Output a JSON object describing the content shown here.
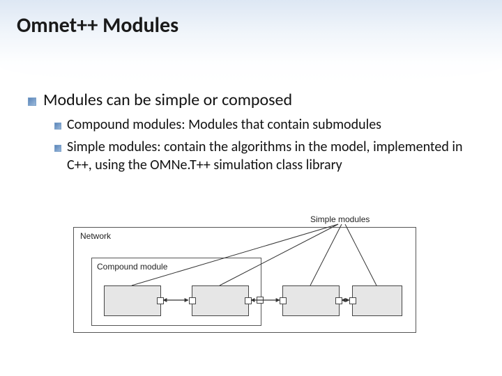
{
  "title": "Omnet++ Modules",
  "bullets": {
    "main": "Modules can be simple or composed",
    "sub1": "Compound modules: Modules that contain submodules",
    "sub2": "Simple modules: contain the algorithms in the model, implemented in C++, using the OMNe.T++ simulation class library"
  },
  "diagram": {
    "network_label": "Network",
    "simple_label": "Simple modules",
    "compound_label": "Compound module"
  }
}
